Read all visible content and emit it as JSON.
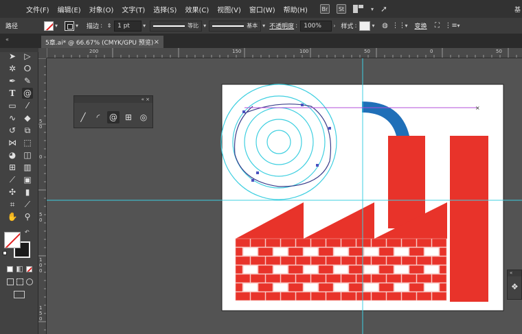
{
  "menubar": {
    "items": [
      "文件(F)",
      "编辑(E)",
      "对象(O)",
      "文字(T)",
      "选择(S)",
      "效果(C)",
      "视图(V)",
      "窗口(W)",
      "帮助(H)"
    ],
    "app_badges": [
      "Br",
      "St"
    ],
    "right_text": "基"
  },
  "controlbar": {
    "mode_label": "路径",
    "stroke_label": "描边",
    "stroke_weight": "1 pt",
    "profile_label": "等比",
    "brush_label": "基本",
    "opacity_label": "不透明度",
    "opacity_value": "100%",
    "style_label": "样式",
    "transform_label": "变换"
  },
  "document": {
    "tab_title": "5章.ai* @ 66.67% (CMYK/GPU 预览)",
    "close_glyph": "×",
    "collapse_glyph": "«"
  },
  "ruler": {
    "h_labels": [
      "200",
      "150",
      "100",
      "50",
      "0",
      "50"
    ],
    "v_labels": [
      "5\n0",
      "0",
      "5\n0",
      "1\n0\n0",
      "1\n5\n0"
    ]
  },
  "tools": [
    "selection-tool",
    "direct-selection-tool",
    "magic-wand-tool",
    "lasso-tool",
    "pen-tool",
    "curvature-tool",
    "type-tool",
    "spiral-tool",
    "rectangle-tool",
    "paintbrush-tool",
    "shaper-tool",
    "eraser-tool",
    "rotate-tool",
    "scale-tool",
    "width-tool",
    "free-transform-tool",
    "shape-builder-tool",
    "perspective-grid-tool",
    "mesh-tool",
    "gradient-tool",
    "eyedropper-tool",
    "blend-tool",
    "symbol-sprayer-tool",
    "column-graph-tool",
    "artboard-tool",
    "slice-tool",
    "hand-tool",
    "zoom-tool"
  ],
  "float_panel": {
    "tools": [
      "line-segment-tool",
      "arc-tool",
      "spiral-tool",
      "rectangular-grid-tool",
      "polar-grid-tool"
    ],
    "header_glyphs": "«  ×"
  },
  "colors": {
    "artwork_red": "#e8332a",
    "pipe_blue": "#1f6fb8",
    "guide_cyan": "#3ecfe0",
    "path_purple": "#b04cd8"
  }
}
